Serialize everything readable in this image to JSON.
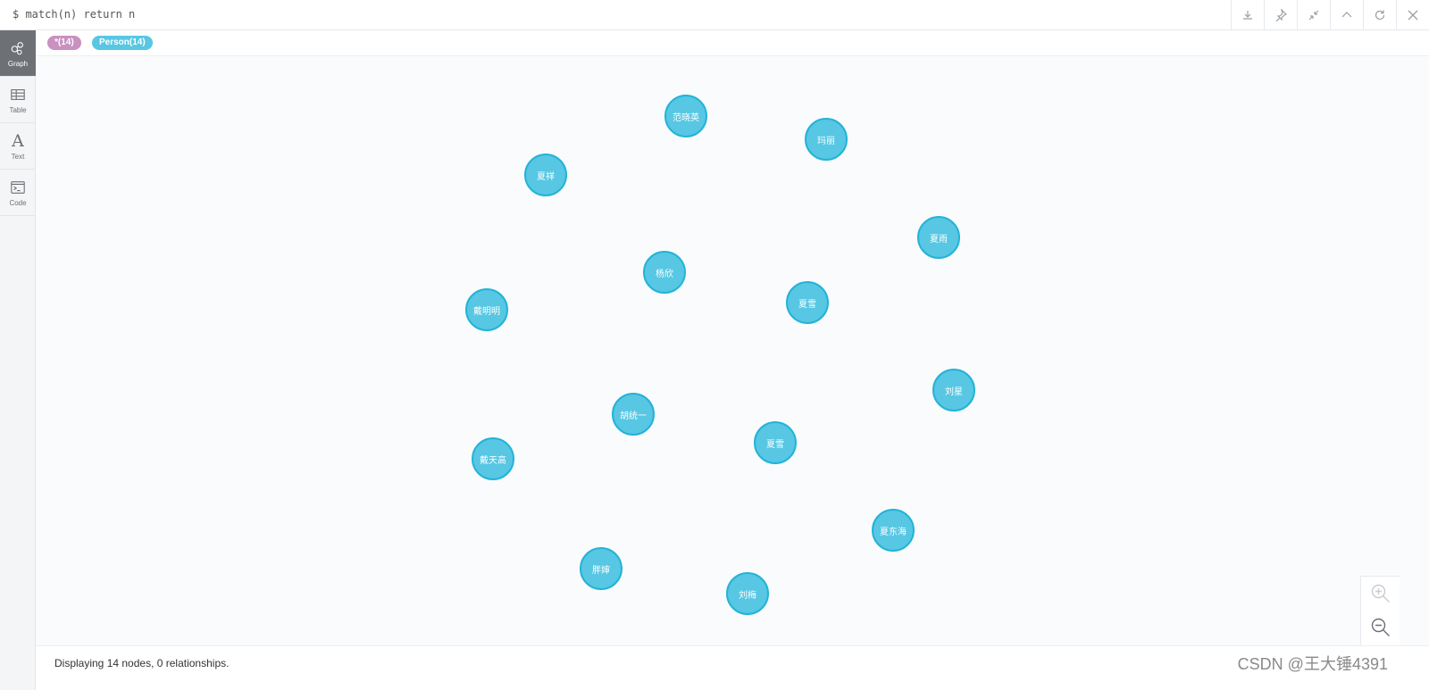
{
  "query": {
    "text": "$ match(n) return n"
  },
  "toolbar": {
    "icons": [
      "download-icon",
      "pin-icon",
      "collapse-icon",
      "chevron-up-icon",
      "refresh-icon",
      "close-icon"
    ]
  },
  "sidebar": {
    "items": [
      {
        "label": "Graph",
        "icon": "graph-icon",
        "active": true
      },
      {
        "label": "Table",
        "icon": "table-icon",
        "active": false
      },
      {
        "label": "Text",
        "icon": "text-icon",
        "active": false
      },
      {
        "label": "Code",
        "icon": "code-icon",
        "active": false
      }
    ]
  },
  "labels": {
    "all": "*(14)",
    "person": "Person(14)"
  },
  "colors": {
    "node_fill": "#57c7e3",
    "node_border": "#23b3d7",
    "all_chip": "#c990c0"
  },
  "graph": {
    "nodes": [
      "范晓英",
      "玛丽",
      "夏祥",
      "夏雨",
      "杨欣",
      "夏雪",
      "戴明明",
      "刘星",
      "胡统一",
      "夏雪",
      "戴天高",
      "夏东海",
      "胖婶",
      "刘梅"
    ]
  },
  "zoom": {
    "in_icon": "zoom-in-icon",
    "out_icon": "zoom-out-icon"
  },
  "footer": {
    "status": "Displaying 14 nodes, 0 relationships.",
    "watermark": "CSDN @王大锤4391"
  }
}
